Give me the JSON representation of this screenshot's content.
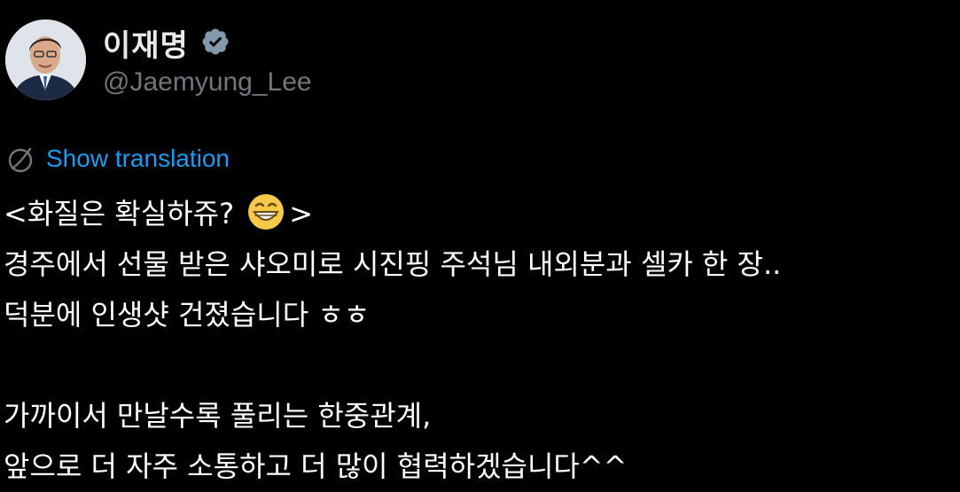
{
  "author": {
    "display_name": "이재명",
    "handle": "@Jaemyung_Lee",
    "verified": true,
    "avatar_icon": "profile-photo"
  },
  "translate": {
    "icon": "globe-icon",
    "label": "Show translation",
    "link_color": "#1d9bf0"
  },
  "tweet": {
    "line1_prefix": "<화질은 확실하쥬?",
    "line1_emoji": "grinning-face-emoji",
    "line1_suffix": ">",
    "line2": "경주에서 선물 받은 샤오미로 시진핑 주석님 내외분과 셀카 한 장..",
    "line3": "덕분에 인생샷 건졌습니다 ㅎㅎ",
    "line5": "가까이서 만날수록 풀리는 한중관계,",
    "line6": "앞으로 더 자주 소통하고 더 많이 협력하겠습니다^^"
  },
  "colors": {
    "background": "#000000",
    "text": "#ffffff",
    "secondary": "#71767b",
    "verified_badge": "#829aab"
  }
}
